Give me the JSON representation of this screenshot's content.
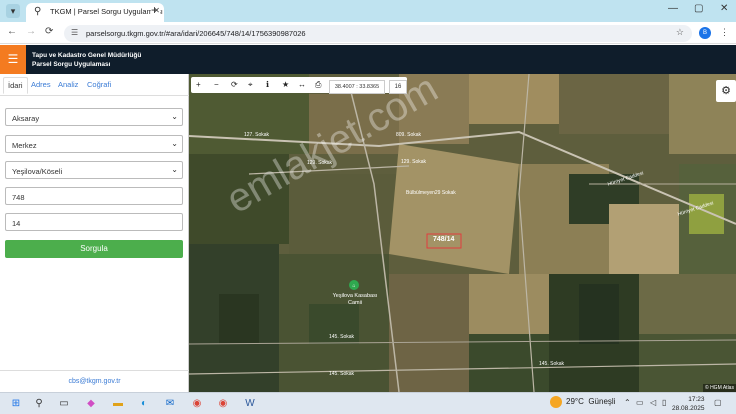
{
  "browser": {
    "tab_title": "TKGM | Parsel Sorgu Uygulaması",
    "url": "parselsorgu.tkgm.gov.tr/#ara/idari/206645/748/14/1756390987026"
  },
  "app": {
    "org_name": "Tapu ve Kadastro Genel Müdürlüğü",
    "app_name": "Parsel Sorgu Uygulaması",
    "accent_color": "#f47b20",
    "header_color": "#0f1d2b"
  },
  "sidebar": {
    "tabs": [
      {
        "label": "İdari",
        "active": true
      },
      {
        "label": "Adres",
        "active": false
      },
      {
        "label": "Analiz",
        "active": false
      },
      {
        "label": "Coğrafi",
        "active": false
      }
    ],
    "province": "Aksaray",
    "district": "Merkez",
    "neighborhood": "Yeşilova/Köseli",
    "block_no": "748",
    "parcel_no": "14",
    "query_button": "Sorgula",
    "contact_email": "cbs@tkgm.gov.tr"
  },
  "map": {
    "coordinates": "38.4007 : 33.8365",
    "zoom": "16",
    "parcel_label": "748/14",
    "watermark": "emlakjet.com",
    "poi_name": "Yeşilova Kasabası Camii",
    "attribution": "© HGM Atlas",
    "streets": [
      "127. Sokak",
      "809. Sokak",
      "129. Sokak",
      "129. Sokak",
      "Bülbülmeyen29 Sokak",
      "Hürriyet Caddesi",
      "Hürriyet Caddesi",
      "145. Sokak",
      "145. Sokak",
      "145. Sokak"
    ]
  },
  "taskbar": {
    "temperature": "29°C",
    "weather": "Güneşli",
    "time": "17:23",
    "date": "28.08.2025"
  }
}
